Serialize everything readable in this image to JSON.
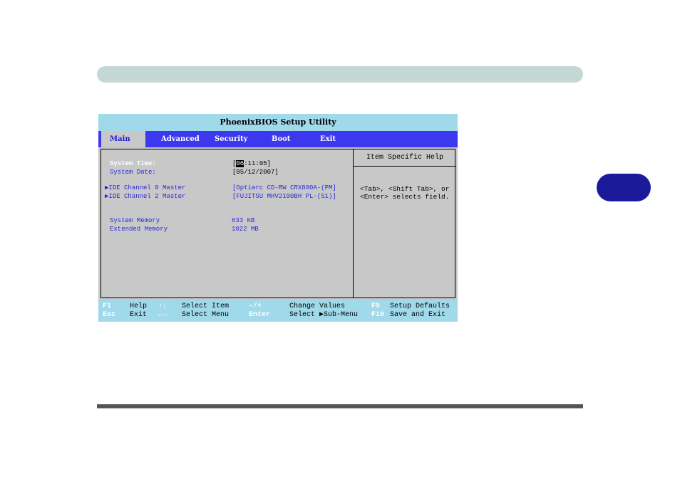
{
  "title": "PhoenixBIOS Setup Utility",
  "menu": [
    {
      "label": "Main",
      "active": true
    },
    {
      "label": "Advanced"
    },
    {
      "label": "Security"
    },
    {
      "label": "Boot"
    },
    {
      "label": "Exit"
    }
  ],
  "fields": {
    "system_time_label": "System Time:",
    "system_time_open": "[",
    "system_time_hour": "06",
    "system_time_rest": ":11:05]",
    "system_date_label": "System Date:",
    "system_date_value": "[05/12/2007]",
    "ide0_label": "IDE Channel 0 Master",
    "ide0_value": "[Optiarc CD-RW CRX880A-(PM]",
    "ide2_label": "IDE Channel 2 Master",
    "ide2_value": "[FUJITSU MHV2100BH PL-(S1)]",
    "system_memory_label": "System Memory",
    "system_memory_value": "633 KB",
    "extended_memory_label": "Extended Memory",
    "extended_memory_value": "1022 MB",
    "submenu_arrow": "▶"
  },
  "help": {
    "title": "Item Specific Help",
    "text": "<Tab>, <Shift Tab>, or\n<Enter> selects field."
  },
  "footer": {
    "f1_key": "F1",
    "f1_desc": "Help",
    "updown_key": "↑↓",
    "updown_desc": "Select Item",
    "minusplus_key": "-/+",
    "minusplus_desc": "Change Values",
    "f9_key": "F9",
    "f9_desc": "Setup Defaults",
    "esc_key": "Esc",
    "esc_desc": "Exit",
    "leftright_key": "←→",
    "leftright_desc": "Select Menu",
    "enter_key": "Enter",
    "enter_desc_pre": "Select ",
    "enter_arrow": "▶",
    "enter_desc_post": "Sub-Menu",
    "f10_key": "F10",
    "f10_desc": "Save and Exit"
  },
  "colors": {
    "title_bar": "#9fd9ea",
    "menu_bar": "#3b38f0",
    "panel": "#c8c8c8",
    "field_text": "#2a2ad8",
    "side_tab": "#1b1a9b",
    "top_bar": "#c3d7d4"
  }
}
